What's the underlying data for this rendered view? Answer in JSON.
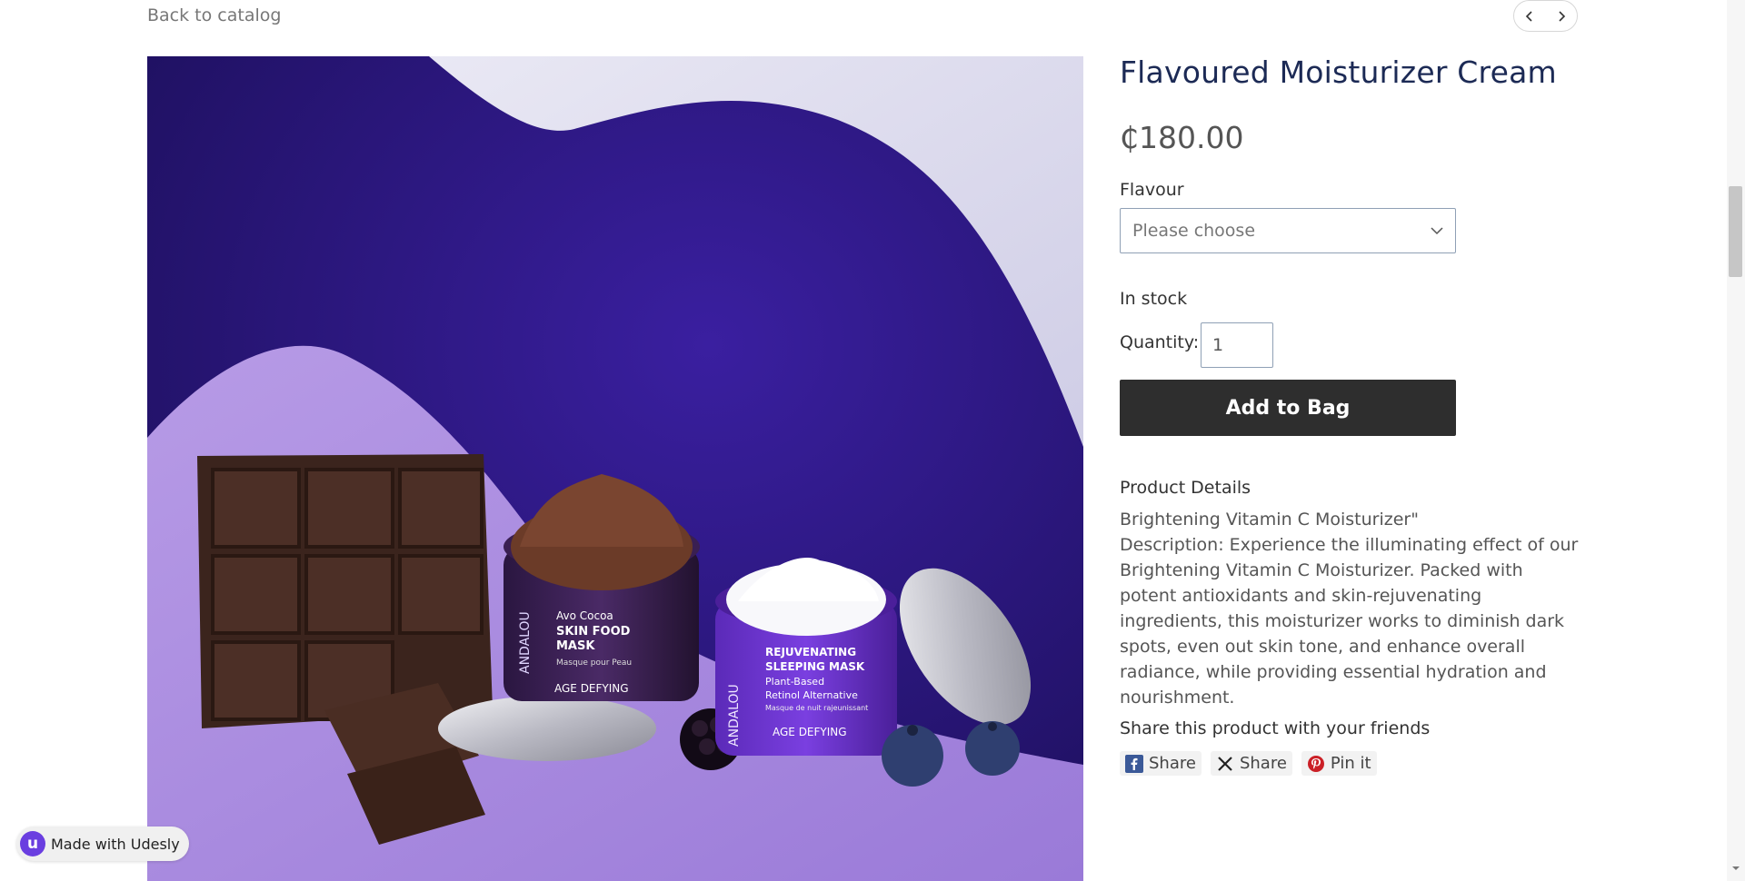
{
  "nav": {
    "back_label": "Back to catalog",
    "prev_icon": "chevron-left-icon",
    "next_icon": "chevron-right-icon"
  },
  "product": {
    "title": "Flavoured Moisturizer Cream",
    "price": "₵180.00",
    "option_label": "Flavour",
    "option_placeholder": "Please choose",
    "stock_status": "In stock",
    "quantity_label": "Quantity:",
    "quantity_value": "1",
    "add_button": "Add to Bag",
    "details_heading": "Product Details",
    "details_lines": [
      "Brightening Vitamin C Moisturizer\"",
      "Description: Experience the illuminating effect of our Brightening Vitamin C Moisturizer. Packed with potent antioxidants and skin-rejuvenating ingredients, this moisturizer works to diminish dark spots, even out skin tone, and enhance overall radiance, while providing essential hydration and nourishment."
    ]
  },
  "image": {
    "left_jar_brand": "ANDALOU",
    "left_jar_line1": "Avo Cocoa",
    "left_jar_line2": "SKIN FOOD",
    "left_jar_line3": "MASK",
    "left_jar_line4": "Masque pour Peau",
    "left_jar_footer": "AGE DEFYING",
    "right_jar_brand": "ANDALOU",
    "right_jar_line1": "REJUVENATING",
    "right_jar_line2": "SLEEPING MASK",
    "right_jar_line3": "Plant-Based",
    "right_jar_line4": "Retinol Alternative",
    "right_jar_line5": "Masque de nuit rajeunissant",
    "right_jar_footer": "AGE DEFYING"
  },
  "share": {
    "heading": "Share this product with your friends",
    "buttons": [
      {
        "label": "Share",
        "icon": "facebook-icon"
      },
      {
        "label": "Share",
        "icon": "x-icon"
      },
      {
        "label": "Pin it",
        "icon": "pinterest-icon"
      }
    ]
  },
  "badge": {
    "logo_letter": "u",
    "label": "Made with Udesly"
  },
  "colors": {
    "title": "#1c2a55",
    "button_bg": "#2e2e2e",
    "image_bg": "#3a2590",
    "facebook": "#3b5998",
    "pinterest": "#cb2027",
    "udesly": "#6a3ee0"
  }
}
